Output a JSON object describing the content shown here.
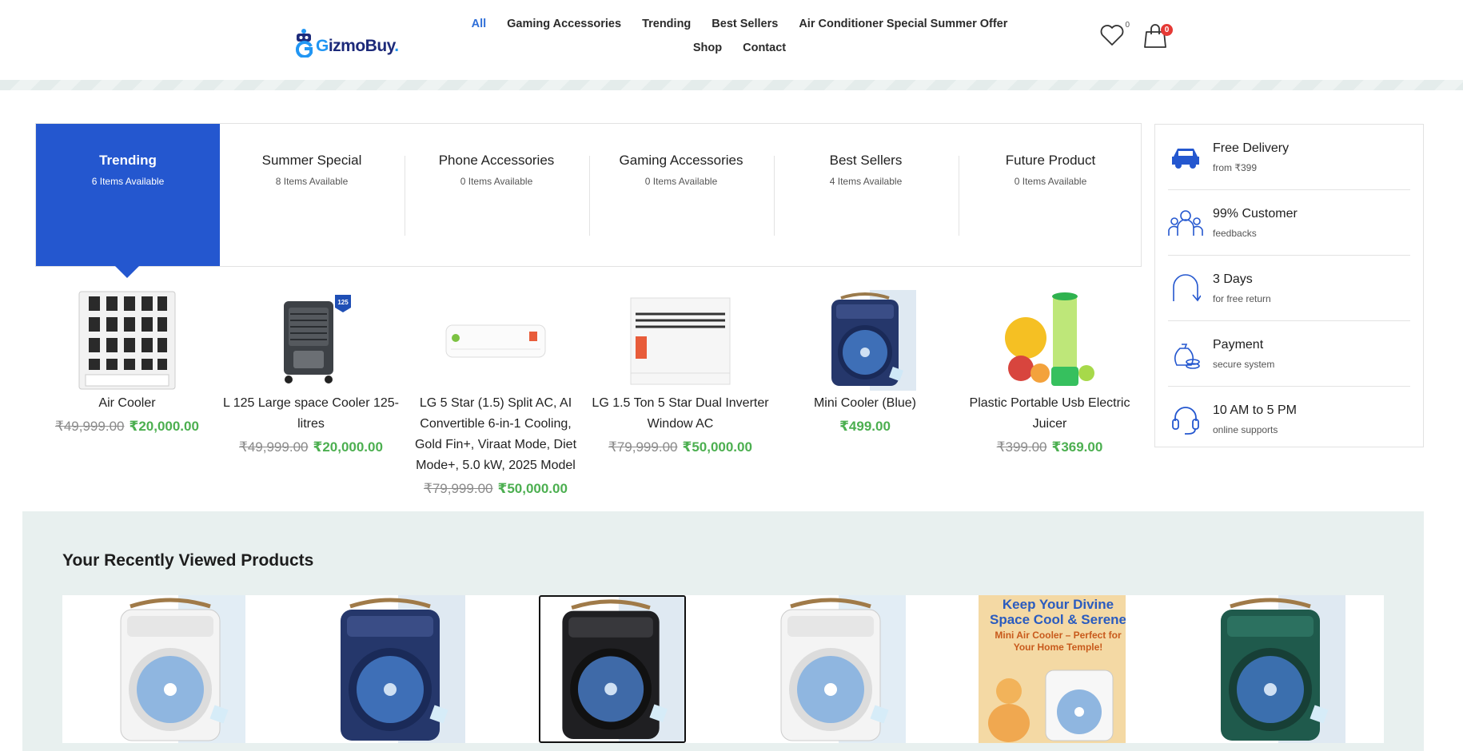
{
  "header": {
    "logo_text": "izmoBuy",
    "logo_g": "G",
    "logo_dot": ".",
    "nav": [
      {
        "label": "All",
        "active": true
      },
      {
        "label": "Gaming Accessories"
      },
      {
        "label": "Trending"
      },
      {
        "label": "Best Sellers"
      },
      {
        "label": "Air Conditioner Special Summer Offer"
      },
      {
        "label": "Shop"
      },
      {
        "label": "Contact"
      }
    ],
    "wishlist_count": "0",
    "cart_count": "0",
    "icons": [
      "heart-icon",
      "shopping-bag-icon"
    ]
  },
  "tabs": [
    {
      "title": "Trending",
      "count": "6 Items Available",
      "active": true
    },
    {
      "title": "Summer Special",
      "count": "8 Items Available"
    },
    {
      "title": "Phone Accessories",
      "count": "0 Items Available"
    },
    {
      "title": "Gaming Accessories",
      "count": "0 Items Available"
    },
    {
      "title": "Best Sellers",
      "count": "4 Items Available"
    },
    {
      "title": "Future Product",
      "count": "0 Items Available"
    }
  ],
  "products": [
    {
      "name": "Air Cooler",
      "old_price": "₹49,999.00",
      "price": "₹20,000.00"
    },
    {
      "name": "L 125 Large space Cooler 125-litres",
      "old_price": "₹49,999.00",
      "price": "₹20,000.00"
    },
    {
      "name": "LG 5 Star (1.5) Split AC, AI Convertible 6-in-1 Cooling, Gold Fin+, Viraat Mode, Diet Mode+, 5.0 kW, 2025 Model",
      "old_price": "₹79,999.00",
      "price": "₹50,000.00"
    },
    {
      "name": "LG 1.5 Ton 5 Star Dual Inverter Window AC",
      "old_price": "₹79,999.00",
      "price": "₹50,000.00"
    },
    {
      "name": "Mini Cooler (Blue)",
      "old_price": "",
      "price": "₹499.00"
    },
    {
      "name": "Plastic Portable Usb Electric Juicer",
      "old_price": "₹399.00",
      "price": "₹369.00"
    }
  ],
  "product_badge": "125",
  "features": [
    {
      "title": "Free Delivery",
      "sub": "from ₹399",
      "icon": "car-icon"
    },
    {
      "title": "99% Customer",
      "sub": "feedbacks",
      "icon": "people-icon"
    },
    {
      "title": "3 Days",
      "sub": "for free return",
      "icon": "return-arrow-icon"
    },
    {
      "title": "Payment",
      "sub": "secure system",
      "icon": "money-bag-icon"
    },
    {
      "title": "10 AM to 5 PM",
      "sub": "online supports",
      "icon": "headset-icon"
    }
  ],
  "recent": {
    "title": "Your Recently Viewed Products",
    "promo_title": "Keep Your Divine Space Cool & Serene",
    "promo_sub": "Mini Air Cooler – Perfect for Your Home Temple!"
  },
  "colors": {
    "accent": "#2457cf",
    "nav_active": "#2f6fd8",
    "price_new": "#4caf50",
    "price_old": "#8a8a8a",
    "recent_bg": "#e8f0ef"
  }
}
